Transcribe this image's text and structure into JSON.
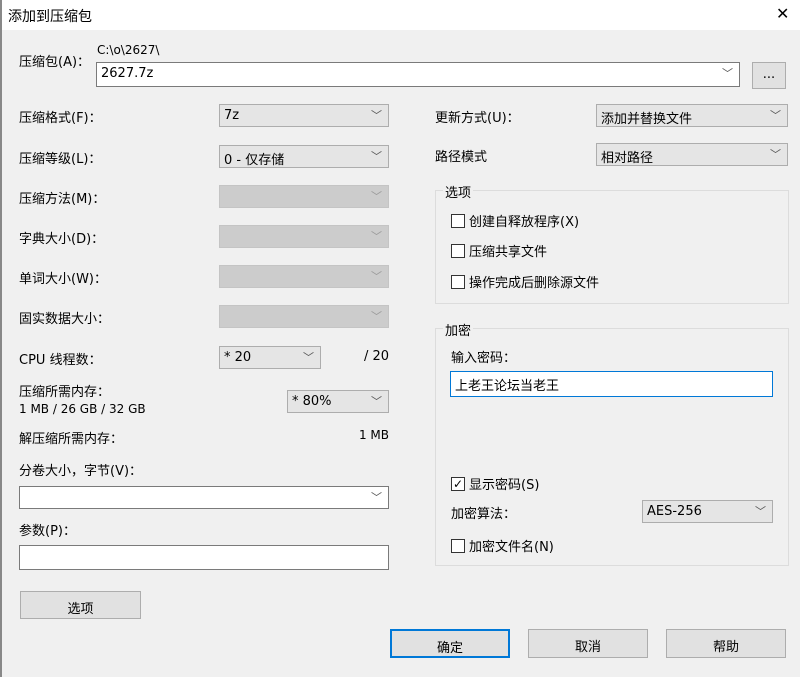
{
  "window": {
    "title": "添加到压缩包",
    "close": "✕"
  },
  "archive": {
    "label": "压缩包(A)：",
    "path": "C:\\o\\2627\\",
    "name": "2627.7z",
    "browse": "..."
  },
  "left": {
    "format": {
      "label": "压缩格式(F)：",
      "value": "7z"
    },
    "level": {
      "label": "压缩等级(L)：",
      "value": "0 - 仅存储"
    },
    "method": {
      "label": "压缩方法(M)："
    },
    "dict": {
      "label": "字典大小(D)："
    },
    "word": {
      "label": "单词大小(W)："
    },
    "solid": {
      "label": "固实数据大小："
    },
    "cpu": {
      "label": "CPU 线程数：",
      "value": "* 20",
      "max": "/ 20"
    },
    "mem": {
      "label": "压缩所需内存：",
      "detail": "1 MB / 26 GB / 32 GB",
      "value": "* 80%"
    },
    "dmem": {
      "label": "解压缩所需内存：",
      "value": "1 MB"
    },
    "split": {
      "label": "分卷大小，字节(V)：",
      "value": ""
    },
    "params": {
      "label": "参数(P)：",
      "value": ""
    },
    "options_button": "选项"
  },
  "right": {
    "update": {
      "label": "更新方式(U)：",
      "value": "添加并替换文件"
    },
    "pathmode": {
      "label": "路径模式",
      "value": "相对路径"
    },
    "options": {
      "title": "选项",
      "sfx": "创建自释放程序(X)",
      "shared": "压缩共享文件",
      "delete": "操作完成后删除源文件"
    },
    "enc": {
      "title": "加密",
      "pw_label": "输入密码：",
      "password": "上老王论坛当老王",
      "show": "显示密码(S)",
      "show_checked": true,
      "alg_label": "加密算法：",
      "alg": "AES-256",
      "encnames": "加密文件名(N)"
    }
  },
  "buttons": {
    "ok": "确定",
    "cancel": "取消",
    "help": "帮助"
  }
}
